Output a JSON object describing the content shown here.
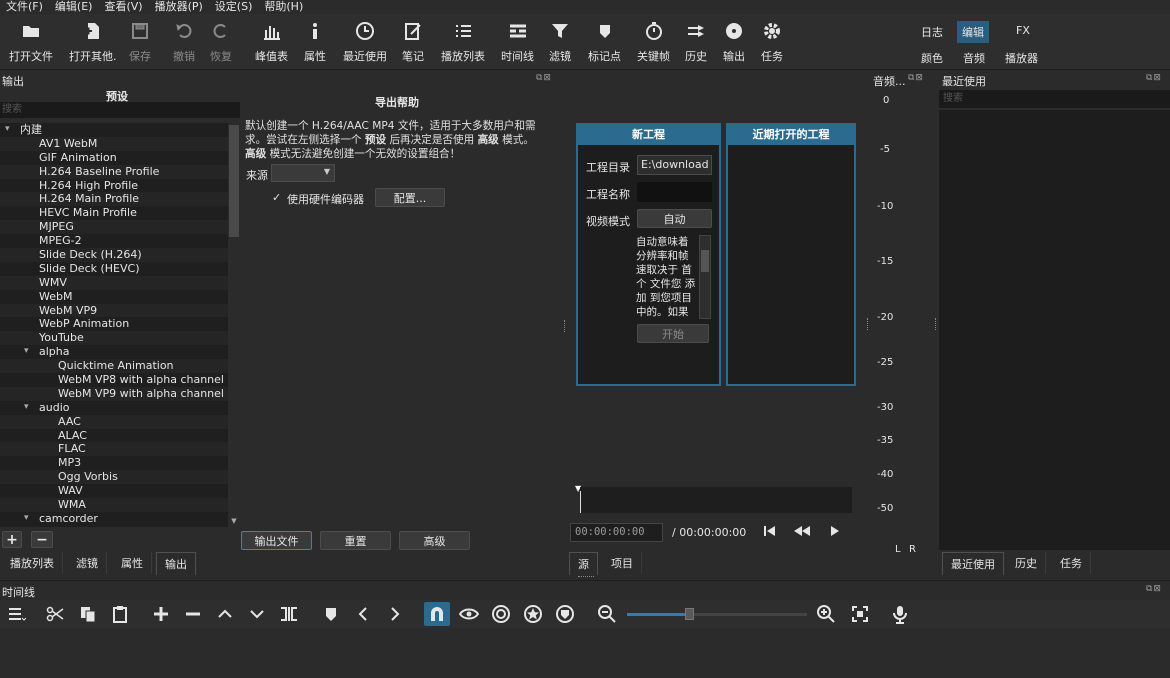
{
  "menu": [
    "文件(F)",
    "编辑(E)",
    "查看(V)",
    "播放器(P)",
    "设定(S)",
    "帮助(H)"
  ],
  "toolbar": {
    "open_file": "打开文件",
    "open_other": "打开其他.",
    "save": "保存",
    "undo": "撤销",
    "redo": "恢复",
    "peak": "峰值表",
    "properties": "属性",
    "recent": "最近使用",
    "notes": "笔记",
    "playlist": "播放列表",
    "timeline": "时间线",
    "filters": "滤镜",
    "markers": "标记点",
    "keyframes": "关键帧",
    "history": "历史",
    "export": "输出",
    "jobs": "任务"
  },
  "layouts": {
    "log": "日志",
    "edit": "编辑",
    "fx": "FX",
    "color": "颜色",
    "audio": "音频",
    "player": "播放器"
  },
  "export_panel": {
    "title": "输出",
    "presets_heading": "预设",
    "search_placeholder": "搜索",
    "help_title": "导出帮助",
    "help_line1_prefix": "默认创建一个 H.264/AAC MP4 文件，适用于大多数用户和需",
    "help_line2_a": "求。尝试在左侧选择一个",
    "help_line2_b": "预设",
    "help_line2_c": "后再决定是否使用",
    "help_line2_d": "高级",
    "help_line2_e": "模式。",
    "help_line3_a": "高级",
    "help_line3_b": "模式无法避免创建一个无效的设置组合！",
    "source_label": "来源",
    "hw_encoder_label": "使用硬件编码器",
    "configure_button": "配置...",
    "export_file_button": "输出文件",
    "reset_button": "重置",
    "advanced_button": "高级",
    "add_symbol": "+",
    "remove_symbol": "−",
    "check_symbol": "✓",
    "presets": [
      {
        "label": "内建",
        "depth": 0,
        "expanded": true
      },
      {
        "label": "AV1 WebM",
        "depth": 1
      },
      {
        "label": "GIF Animation",
        "depth": 1
      },
      {
        "label": "H.264 Baseline Profile",
        "depth": 1
      },
      {
        "label": "H.264 High Profile",
        "depth": 1
      },
      {
        "label": "H.264 Main Profile",
        "depth": 1
      },
      {
        "label": "HEVC Main Profile",
        "depth": 1
      },
      {
        "label": "MJPEG",
        "depth": 1
      },
      {
        "label": "MPEG-2",
        "depth": 1
      },
      {
        "label": "Slide Deck (H.264)",
        "depth": 1
      },
      {
        "label": "Slide Deck (HEVC)",
        "depth": 1
      },
      {
        "label": "WMV",
        "depth": 1
      },
      {
        "label": "WebM",
        "depth": 1
      },
      {
        "label": "WebM VP9",
        "depth": 1
      },
      {
        "label": "WebP Animation",
        "depth": 1
      },
      {
        "label": "YouTube",
        "depth": 1
      },
      {
        "label": "alpha",
        "depth": 1,
        "expanded": true
      },
      {
        "label": "Quicktime Animation",
        "depth": 2
      },
      {
        "label": "WebM VP8 with alpha channel",
        "depth": 2
      },
      {
        "label": "WebM VP9 with alpha channel",
        "depth": 2
      },
      {
        "label": "audio",
        "depth": 1,
        "expanded": true
      },
      {
        "label": "AAC",
        "depth": 2
      },
      {
        "label": "ALAC",
        "depth": 2
      },
      {
        "label": "FLAC",
        "depth": 2
      },
      {
        "label": "MP3",
        "depth": 2
      },
      {
        "label": "Ogg Vorbis",
        "depth": 2
      },
      {
        "label": "WAV",
        "depth": 2
      },
      {
        "label": "WMA",
        "depth": 2
      },
      {
        "label": "camcorder",
        "depth": 1,
        "expanded": true
      }
    ]
  },
  "left_tabs": [
    "播放列表",
    "滤镜",
    "属性",
    "输出"
  ],
  "new_project": {
    "title": "新工程",
    "dir_label": "工程目录",
    "dir_value": "E:\\download",
    "name_label": "工程名称",
    "mode_label": "视频模式",
    "mode_value": "自动",
    "desc_lines": [
      "自动意味着",
      "分辨率和帧",
      "速取决于 首",
      "个 文件您 添",
      "加 到您项目",
      "中的。如果"
    ],
    "start_button": "开始"
  },
  "recent_projects": {
    "title": "近期打开的工程"
  },
  "player": {
    "timecode": "00:00:00:00",
    "duration": "/ 00:00:00:00",
    "tabs": [
      "源",
      "项目"
    ]
  },
  "audio_meter": {
    "title": "音频...",
    "scale": [
      "0",
      "-5",
      "-10",
      "-15",
      "-20",
      "-25",
      "-30",
      "-35",
      "-40",
      "-50"
    ],
    "left": "L",
    "right": "R"
  },
  "recent_panel": {
    "title": "最近使用",
    "search_placeholder": "搜索",
    "tabs": [
      "最近使用",
      "历史",
      "任务"
    ]
  },
  "timeline": {
    "title": "时间线"
  }
}
